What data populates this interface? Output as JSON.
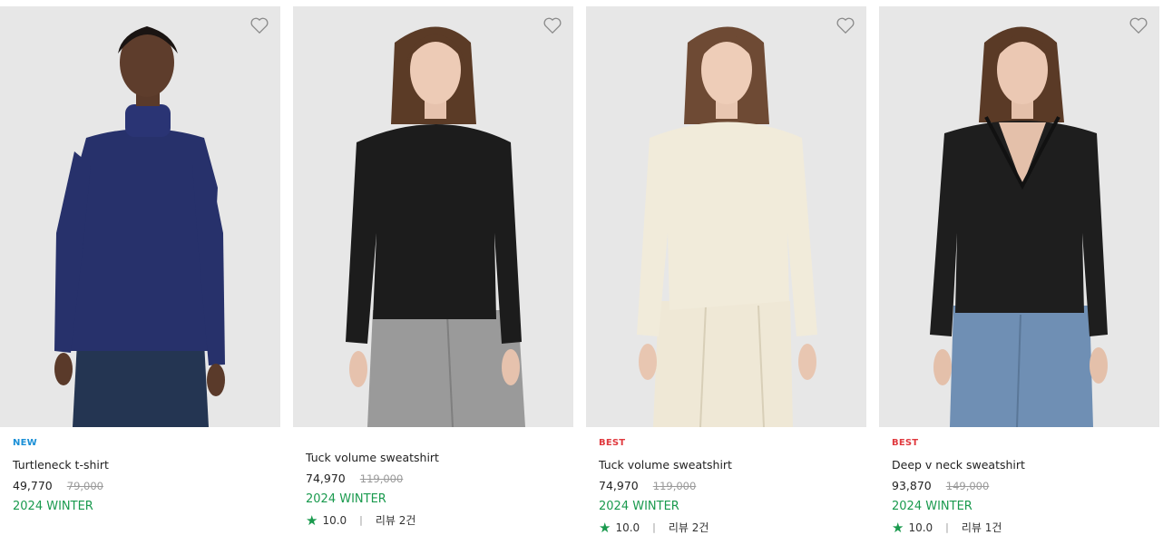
{
  "products": [
    {
      "badge": "NEW",
      "badge_type": "new",
      "name": "Turtleneck t-shirt",
      "price": "49,770",
      "original_price": "79,000",
      "season": "2024 WINTER",
      "rating": null,
      "review": null,
      "image_icon": "model-turtleneck-navy",
      "garment_color": "#27316b"
    },
    {
      "badge": null,
      "name": "Tuck volume sweatshirt",
      "price": "74,970",
      "original_price": "119,000",
      "season": "2024 WINTER",
      "rating": "10.0",
      "review": "리뷰 2건",
      "image_icon": "model-sweatshirt-black",
      "garment_color": "#1c1c1c"
    },
    {
      "badge": "BEST",
      "badge_type": "best",
      "name": "Tuck volume sweatshirt",
      "price": "74,970",
      "original_price": "119,000",
      "season": "2024 WINTER",
      "rating": "10.0",
      "review": "리뷰 2건",
      "image_icon": "model-sweatshirt-cream",
      "garment_color": "#f1ebda"
    },
    {
      "badge": "BEST",
      "badge_type": "best",
      "name": "Deep v neck sweatshirt",
      "price": "93,870",
      "original_price": "149,000",
      "season": "2024 WINTER",
      "rating": "10.0",
      "review": "리뷰 1건",
      "image_icon": "model-vneck-black",
      "garment_color": "#1e1e1e"
    }
  ],
  "icons": {
    "wishlist": "heart-outline-icon",
    "rating": "star-icon"
  },
  "colors": {
    "season": "#1a9a4e",
    "badge_new": "#1a8fd6",
    "badge_best": "#e0393e",
    "photo_bg": "#e7e7e7"
  }
}
